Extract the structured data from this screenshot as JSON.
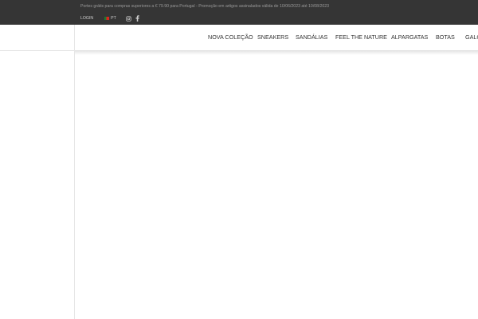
{
  "topbar": {
    "promo_text": "Portes grátis para compras superiores a € 79.90 para Portugal - Promoção em artigos assinalados válida de 10/06/2023 até 10/08/2023",
    "login_label": "LOGIN",
    "language_label": "PT",
    "social_icons": [
      "instagram-icon",
      "facebook-icon"
    ]
  },
  "nav": {
    "items": [
      {
        "label": "NOVA COLEÇÃO"
      },
      {
        "label": "SNEAKERS"
      },
      {
        "label": "SANDÁLIAS"
      },
      {
        "label": "FEEL THE NATURE"
      },
      {
        "label": "ALPARGATAS"
      },
      {
        "label": "BOTAS"
      },
      {
        "label": "GALO"
      }
    ]
  },
  "colors": {
    "topbar_bg": "#353535",
    "nav_text": "#333333",
    "page_bg": "#ffffff"
  }
}
